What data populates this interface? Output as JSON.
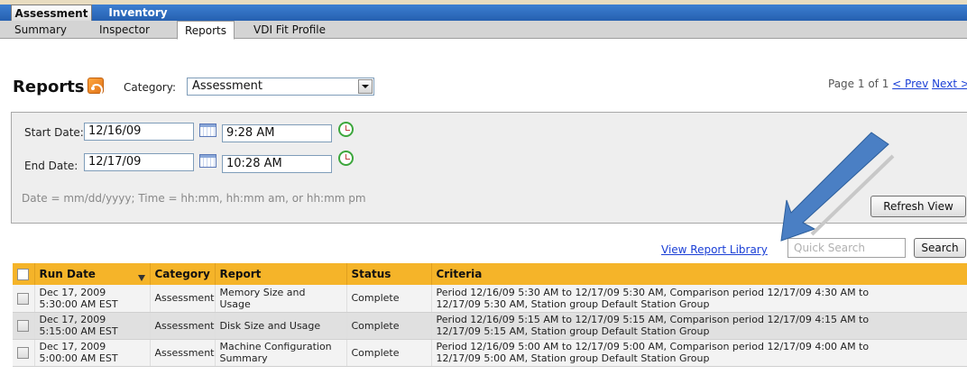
{
  "main_tabs": [
    {
      "label": "Assessment",
      "active": true
    },
    {
      "label": "Inventory",
      "active": false
    }
  ],
  "sub_tabs": [
    {
      "label": "Summary",
      "active": false
    },
    {
      "label": "Inspector",
      "active": false
    },
    {
      "label": "Reports",
      "active": true
    },
    {
      "label": "VDI Fit Profile",
      "active": false
    }
  ],
  "page": {
    "title": "Reports",
    "category_label": "Category:",
    "category_value": "Assessment",
    "pager": {
      "text": "Page 1 of 1",
      "prev": "< Prev",
      "next": "Next >"
    }
  },
  "filters": {
    "start_label": "Start Date:",
    "start_date": "12/16/09",
    "start_time": "9:28 AM",
    "end_label": "End Date:",
    "end_date": "12/17/09",
    "end_time": "10:28 AM",
    "hint": "Date = mm/dd/yyyy; Time = hh:mm, hh:mm am, or hh:mm pm",
    "refresh_label": "Refresh View"
  },
  "toolbar": {
    "library_link": "View Report Library",
    "search_placeholder": "Quick Search",
    "search_button": "Search"
  },
  "table": {
    "columns": [
      "Run Date",
      "Category",
      "Report",
      "Status",
      "Criteria"
    ],
    "rows": [
      {
        "run_date": [
          "Dec 17, 2009",
          "5:30:00 AM EST"
        ],
        "category": "Assessment",
        "report": [
          "Memory Size and",
          "Usage"
        ],
        "status": "Complete",
        "criteria": [
          "Period 12/16/09 5:30 AM to 12/17/09 5:30 AM, Comparison period 12/17/09 4:30 AM to",
          "12/17/09 5:30 AM, Station group Default Station Group"
        ]
      },
      {
        "run_date": [
          "Dec 17, 2009",
          "5:15:00 AM EST"
        ],
        "category": "Assessment",
        "report": [
          "Disk Size and Usage"
        ],
        "status": "Complete",
        "criteria": [
          "Period 12/16/09 5:15 AM to 12/17/09 5:15 AM, Comparison period 12/17/09 4:15 AM to",
          "12/17/09 5:15 AM, Station group Default Station Group"
        ]
      },
      {
        "run_date": [
          "Dec 17, 2009",
          "5:00:00 AM EST"
        ],
        "category": "Assessment",
        "report": [
          "Machine Configuration",
          "Summary"
        ],
        "status": "Complete",
        "criteria": [
          "Period 12/16/09 5:00 AM to 12/17/09 5:00 AM, Comparison period 12/17/09 4:00 AM to",
          "12/17/09 5:00 AM, Station group Default Station Group"
        ]
      }
    ]
  },
  "colors": {
    "main_tab_bar": "#2f6dc4",
    "table_header": "#f5b429",
    "callout_arrow": "#4a7fc4",
    "link": "#1a3fd6"
  }
}
